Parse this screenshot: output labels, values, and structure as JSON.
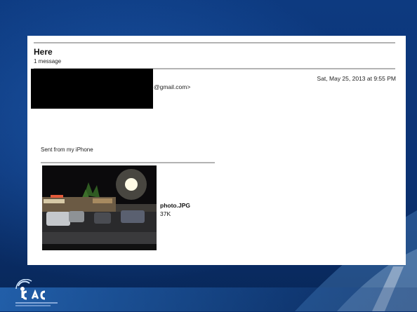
{
  "email": {
    "subject": "Here",
    "message_count": "1 message",
    "sender_visible": "@gmail.com>",
    "date": "Sat, May 25, 2013 at 9:55 PM",
    "signature": "Sent from my iPhone",
    "attachment": {
      "filename": "photo.JPG",
      "size": "37K"
    }
  },
  "branding": {
    "logo": "ICAC"
  },
  "colors": {
    "slide_background": "#0b3273",
    "card": "#ffffff",
    "rule": "#b3b3b3",
    "redaction": "#000000"
  }
}
